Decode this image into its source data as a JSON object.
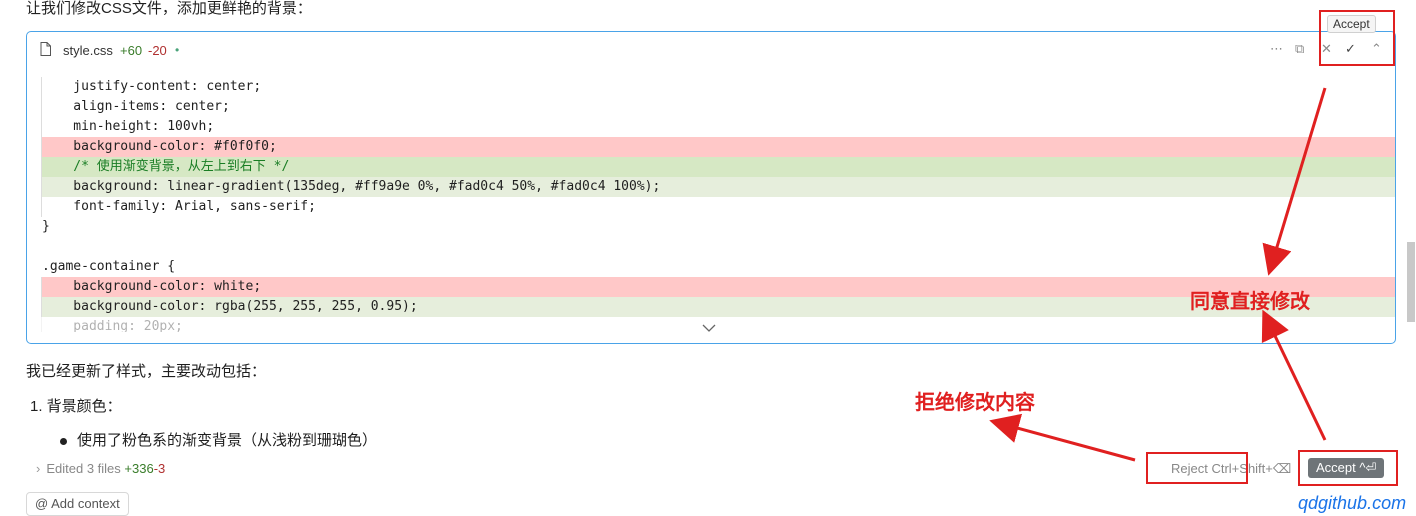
{
  "intro_text": "让我们修改CSS文件，添加更鲜艳的背景：",
  "file": {
    "name": "style.css",
    "added": "+60",
    "removed": "-20",
    "dot": "•"
  },
  "header_icons": {
    "more": "⋯",
    "copy": "⧉",
    "reject": "✕",
    "accept": "✓",
    "expand": "⌃"
  },
  "tooltip": "Accept",
  "code_lines": [
    {
      "type": "ctx",
      "text": "    justify-content: center;"
    },
    {
      "type": "ctx",
      "text": "    align-items: center;"
    },
    {
      "type": "ctx",
      "text": "    min-height: 100vh;"
    },
    {
      "type": "del",
      "text": "    background-color: #f0f0f0;"
    },
    {
      "type": "add-strong",
      "text": "    /* 使用渐变背景，从左上到右下 */"
    },
    {
      "type": "add",
      "text": "    background: linear-gradient(135deg, #ff9a9e 0%, #fad0c4 50%, #fad0c4 100%);"
    },
    {
      "type": "ctx",
      "text": "    font-family: Arial, sans-serif;"
    },
    {
      "type": "ctx",
      "text": "}"
    },
    {
      "type": "ctx",
      "text": ""
    },
    {
      "type": "ctx",
      "text": ".game-container {"
    },
    {
      "type": "del",
      "text": "    background-color: white;"
    },
    {
      "type": "add",
      "text": "    background-color: rgba(255, 255, 255, 0.95);"
    },
    {
      "type": "ctx",
      "text": "    padding: 20px;"
    }
  ],
  "summary": "我已经更新了样式，主要改动包括：",
  "list_item": "1. 背景颜色：",
  "sub_item": "使用了粉色系的渐变背景（从浅粉到珊瑚色）",
  "bottom": {
    "edited_label": "Edited 3 files",
    "plus": "+336",
    "minus": "-3",
    "reject": "Reject Ctrl+Shift+⌫",
    "accept": "Accept ^⏎"
  },
  "add_context": "Add context",
  "annotations": {
    "accept_note": "同意直接修改",
    "reject_note": "拒绝修改内容"
  },
  "watermark": "qdgithub.com",
  "colors": {
    "accent_border": "#4aa3e8",
    "annotation_red": "#e02020"
  }
}
